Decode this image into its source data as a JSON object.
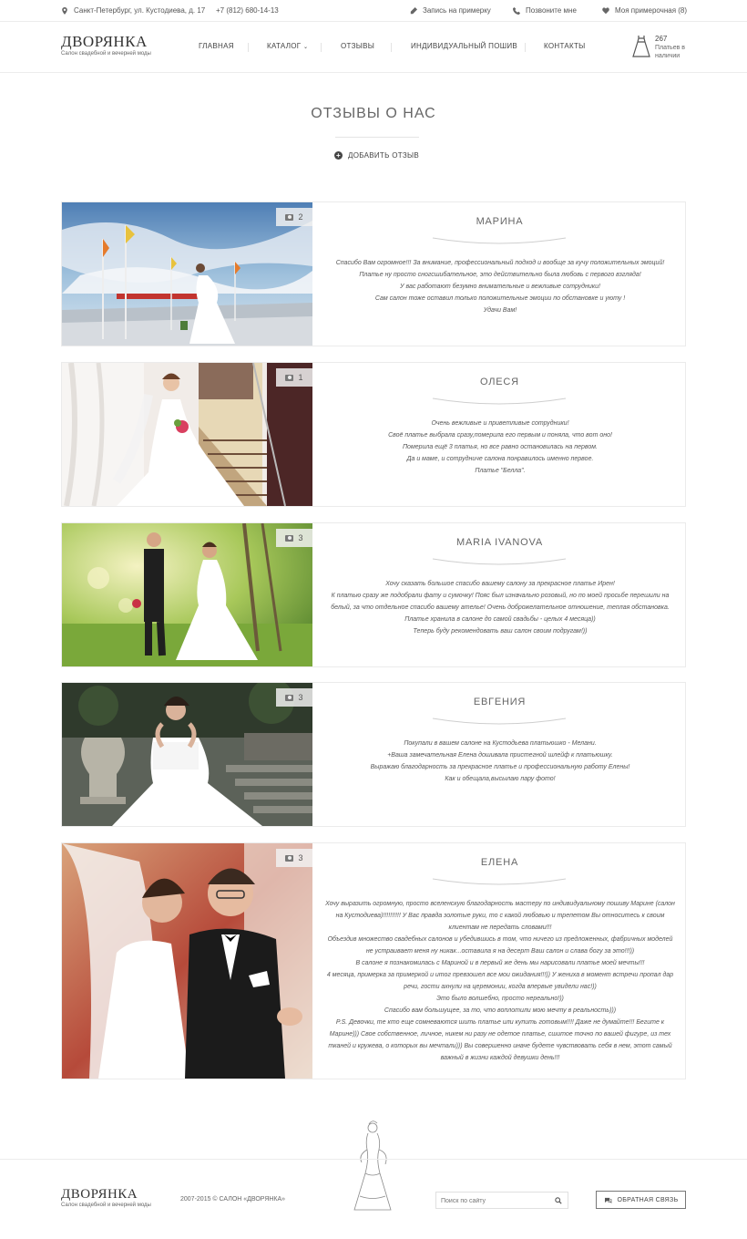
{
  "topbar": {
    "address": "Санкт-Петербург, ул. Кустодиева, д. 17",
    "phone": "+7 (812) 680-14-13",
    "fitting": "Запись на примерку",
    "callback": "Позвоните мне",
    "my_fitting": "Моя примерочная (8)"
  },
  "header": {
    "logo": "ДВОРЯНКА",
    "logo_sub": "Салон свадебной и вечерней моды",
    "nav": [
      "ГЛАВНАЯ",
      "КАТАЛОГ",
      "ОТЗЫВЫ",
      "ИНДИВИДУАЛЬНЫЙ ПОШИВ",
      "КОНТАКТЫ"
    ],
    "dress_count": "267",
    "dress_count_label": "Платьев в наличии"
  },
  "page": {
    "title": "ОТЗЫВЫ О НАС",
    "add_review": "ДОБАВИТЬ ОТЗЫВ"
  },
  "reviews": [
    {
      "name": "МАРИНА",
      "photo_count": "2",
      "text": "Спасибо Вам огромное!!! За внимание, профессиональный подход и вообще за кучу положительных эмоций!\nПлатье ну просто сногсшибательное, это действительно была любовь с первого взгляда!\nУ вас работают безумно внимательные и вежливые сотрудники!\nСам салон тоже оставил только положительные эмоции по обстановке и уюту !\nУдачи Вам!"
    },
    {
      "name": "ОЛЕСЯ",
      "photo_count": "1",
      "text": "Очень вежливые и приветливые сотрудники!\nСвоё платье выбрала сразу,померила его первым и поняла, что вот оно!\nПомерила ещё 3 платья, но все равно остановилась на первом.\nДа и маме, и сотрудниче салона понравилось именно первое.\nПлатье \"Белла\"."
    },
    {
      "name": "MARIA IVANOVA",
      "photo_count": "3",
      "text": "Хочу сказать большое спасибо вашему салону за прекрасное платье Ирен!\nК платью сразу же подобрали фату и сумочку! Пояс был изначально розовый, но по моей просьбе перешили на белый, за что отдельное спасибо вашему ателье! Очень доброжелательное отношение, теплая обстановка. Платье хранила в салоне до самой свадьбы - целых 4 месяца))\nТеперь буду рекомендовать ваш салон своим подругам!))"
    },
    {
      "name": "ЕВГЕНИЯ",
      "photo_count": "3",
      "text": "Покупали в вашем салоне на Кустодьева платьюшко - Мелани.\n+Ваша замечательная Елена дошивала пристегной шлейф к платьюшку.\nВыражаю благодарность за прекрасное платье и профессиональную работу Елены!\nКак и обещала,высылаю пару фото!"
    },
    {
      "name": "ЕЛЕНА",
      "photo_count": "3",
      "text": "Хочу выразить огромную, просто вселенскую благодарность мастеру по индивидуальному пошиву Марине (салон на Кустодиева)!!!!!!!!!! У Вас правда золотые руки, то с какой любовью и трепетом Вы относитесь к своим клиентам не передать словами!!!\nОбъездив множество свадебных салонов и убедившись в том, что ничего из предложенных, фабричных моделей не устраивает меня ну никак...оставила я на десерт Ваш салон и слава богу за это!!!))\nВ салоне я познакомилась с Мариной и в первый же день мы нарисовали платье моей мечты!!!\n4 месяца, примерка за примеркой и итог превзошел все мои ожидания!!!)) У жениха в момент встречи пропал дар речи, гости ахнули на церемонии, когда впервые увидели нас!))\nЭто было волшебно, просто нереально!))\nСпасибо вам большущее, за то, что воплотили мою мечту в реальность)))\nP.S. Девочки, те кто еще сомневаются шить платье или купить готовым!!!! Даже не думайте!!! Бегите к Марине))) Свое собственное, личное, никем ни разу не одетое платье, сшитое точно по вашей фигуре, из тех тканей и кружева, о которых вы мечтали))) Вы совершенно иначе будете чувствовать себя в нем, этот самый важный в жизни каждой девушки день!!!"
    }
  ],
  "footer": {
    "logo": "ДВОРЯНКА",
    "logo_sub": "Салон свадебной и вечерней моды",
    "copyright": "2007-2015 © САЛОН «ДВОРЯНКА»",
    "search_placeholder": "Поиск по сайту",
    "feedback": "ОБРАТНАЯ СВЯЗЬ"
  },
  "colors": {
    "text": "#555555",
    "border": "#ebebeb",
    "background": "#ffffff"
  }
}
